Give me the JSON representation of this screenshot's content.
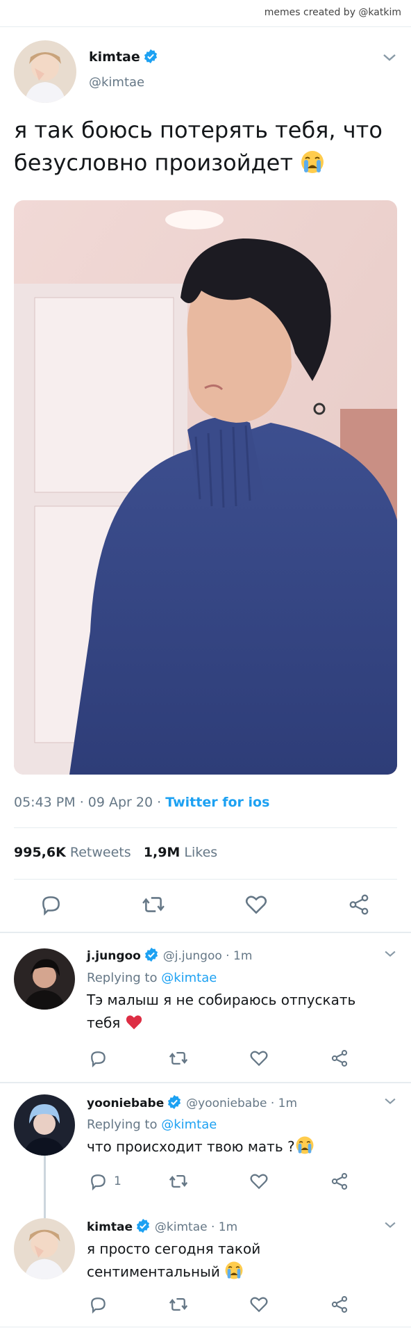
{
  "credit": "memes created by @katkim",
  "tweet": {
    "name": "kimtae",
    "handle": "@kimtae",
    "text": "я так боюсь потерять тебя, что безусловно произойдет",
    "time": "05:43 PM",
    "date": "09 Apr 20",
    "source": "Twitter for ios",
    "retweets_count": "995,6K",
    "retweets_label": "Retweets",
    "likes_count": "1,9M",
    "likes_label": "Likes"
  },
  "replies": [
    {
      "name": "j.jungoo",
      "handle": "@j.jungoo",
      "time": "1m",
      "replying_label": "Replying to",
      "replying_to": "@kimtae",
      "text": "Тэ малыш я не собираюсь отпускать тебя",
      "reply_count": ""
    },
    {
      "name": "yooniebabe",
      "handle": "@yooniebabe",
      "time": "1m",
      "replying_label": "Replying to",
      "replying_to": "@kimtae",
      "text": "что происходит твою мать ?",
      "reply_count": "1"
    },
    {
      "name": "kimtae",
      "handle": "@kimtae",
      "time": "1m",
      "text": "я просто сегодня такой сентиментальный",
      "reply_count": ""
    }
  ],
  "colors": {
    "accent": "#1da1f2",
    "text": "#14171a",
    "muted": "#657786",
    "divider": "#e6ecf0"
  },
  "icons": [
    "verified-icon",
    "chevron-down-icon",
    "reply-icon",
    "retweet-icon",
    "like-icon",
    "share-icon",
    "crying-emoji",
    "red-heart-emoji"
  ]
}
